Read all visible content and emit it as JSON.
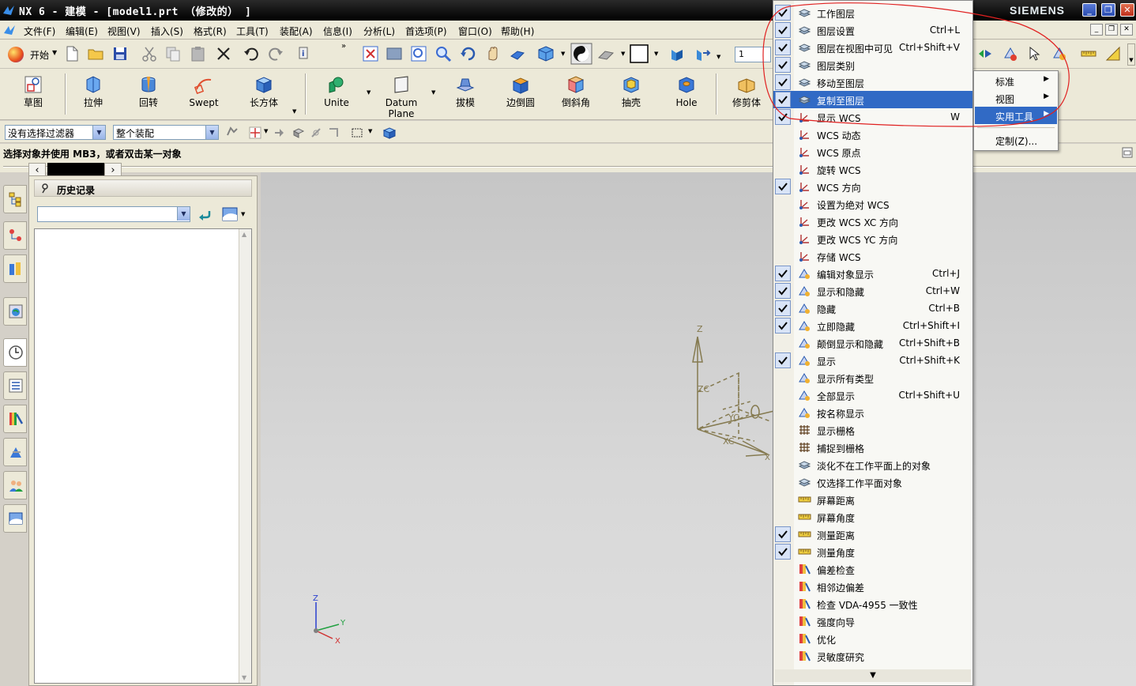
{
  "window": {
    "title": "NX 6 - 建模 - [model1.prt （修改的） ]",
    "brand": "SIEMENS"
  },
  "menubar": {
    "items": [
      "文件(F)",
      "编辑(E)",
      "视图(V)",
      "插入(S)",
      "格式(R)",
      "工具(T)",
      "装配(A)",
      "信息(I)",
      "分析(L)",
      "首选项(P)",
      "窗口(O)",
      "帮助(H)"
    ]
  },
  "toolbar": {
    "start_label": "开始",
    "layer_value": "1"
  },
  "features": [
    {
      "label": "草图",
      "icon": "sketch-icon"
    },
    {
      "label": "拉伸",
      "icon": "extrude-icon"
    },
    {
      "label": "回转",
      "icon": "revolve-icon"
    },
    {
      "label": "Swept",
      "icon": "swept-icon"
    },
    {
      "label": "长方体",
      "icon": "block-icon"
    },
    {
      "label": "Unite",
      "icon": "unite-icon"
    },
    {
      "label": "Datum Plane",
      "icon": "datum-plane-icon"
    },
    {
      "label": "拔模",
      "icon": "draft-icon"
    },
    {
      "label": "边倒圆",
      "icon": "edge-blend-icon"
    },
    {
      "label": "倒斜角",
      "icon": "chamfer-icon"
    },
    {
      "label": "抽壳",
      "icon": "shell-icon"
    },
    {
      "label": "Hole",
      "icon": "hole-icon"
    },
    {
      "label": "修剪体",
      "icon": "trim-body-icon"
    }
  ],
  "selection": {
    "filter": "没有选择过滤器",
    "scope": "整个装配"
  },
  "status": {
    "message": "选择对象并使用 MB3，或者双击某一对象"
  },
  "history_panel": {
    "title": "历史记录"
  },
  "context_menu": {
    "items": [
      {
        "label": "工作图层",
        "shortcut": "",
        "checked": true
      },
      {
        "label": "图层设置",
        "shortcut": "Ctrl+L",
        "checked": true
      },
      {
        "label": "图层在视图中可见",
        "shortcut": "Ctrl+Shift+V",
        "checked": true
      },
      {
        "label": "图层类别",
        "shortcut": "",
        "checked": true
      },
      {
        "label": "移动至图层",
        "shortcut": "",
        "checked": true
      },
      {
        "label": "复制至图层",
        "shortcut": "",
        "checked": true
      },
      {
        "label": "显示 WCS",
        "shortcut": "W",
        "checked": true
      },
      {
        "label": "WCS 动态",
        "shortcut": "",
        "checked": false
      },
      {
        "label": "WCS 原点",
        "shortcut": "",
        "checked": false
      },
      {
        "label": "旋转 WCS",
        "shortcut": "",
        "checked": false
      },
      {
        "label": "WCS 方向",
        "shortcut": "",
        "checked": true
      },
      {
        "label": "设置为绝对 WCS",
        "shortcut": "",
        "checked": false
      },
      {
        "label": "更改 WCS XC 方向",
        "shortcut": "",
        "checked": false
      },
      {
        "label": "更改 WCS YC 方向",
        "shortcut": "",
        "checked": false
      },
      {
        "label": "存储 WCS",
        "shortcut": "",
        "checked": false
      },
      {
        "label": "编辑对象显示",
        "shortcut": "Ctrl+J",
        "checked": true
      },
      {
        "label": "显示和隐藏",
        "shortcut": "Ctrl+W",
        "checked": true
      },
      {
        "label": "隐藏",
        "shortcut": "Ctrl+B",
        "checked": true
      },
      {
        "label": "立即隐藏",
        "shortcut": "Ctrl+Shift+I",
        "checked": true
      },
      {
        "label": "颠倒显示和隐藏",
        "shortcut": "Ctrl+Shift+B",
        "checked": false
      },
      {
        "label": "显示",
        "shortcut": "Ctrl+Shift+K",
        "checked": true
      },
      {
        "label": "显示所有类型",
        "shortcut": "",
        "checked": false
      },
      {
        "label": "全部显示",
        "shortcut": "Ctrl+Shift+U",
        "checked": false
      },
      {
        "label": "按名称显示",
        "shortcut": "",
        "checked": false
      },
      {
        "label": "显示栅格",
        "shortcut": "",
        "checked": false
      },
      {
        "label": "捕捉到栅格",
        "shortcut": "",
        "checked": false
      },
      {
        "label": "淡化不在工作平面上的对象",
        "shortcut": "",
        "checked": false
      },
      {
        "label": "仅选择工作平面对象",
        "shortcut": "",
        "checked": false
      },
      {
        "label": "屏幕距离",
        "shortcut": "",
        "checked": false
      },
      {
        "label": "屏幕角度",
        "shortcut": "",
        "checked": false
      },
      {
        "label": "测量距离",
        "shortcut": "",
        "checked": true
      },
      {
        "label": "测量角度",
        "shortcut": "",
        "checked": true
      },
      {
        "label": "偏差检查",
        "shortcut": "",
        "checked": false
      },
      {
        "label": "相邻边偏差",
        "shortcut": "",
        "checked": false
      },
      {
        "label": "检查 VDA-4955 一致性",
        "shortcut": "",
        "checked": false
      },
      {
        "label": "强度向导",
        "shortcut": "",
        "checked": false
      },
      {
        "label": "优化",
        "shortcut": "",
        "checked": false
      },
      {
        "label": "灵敏度研究",
        "shortcut": "",
        "checked": false
      }
    ],
    "highlighted_index": 5
  },
  "submenu": {
    "items": [
      {
        "label": "标准",
        "has_arrow": true
      },
      {
        "label": "视图",
        "has_arrow": true
      },
      {
        "label": "实用工具",
        "has_arrow": true
      },
      {
        "label": "定制(Z)...",
        "has_arrow": false
      }
    ],
    "highlighted_index": 2
  },
  "triad": {
    "z": "Z",
    "y": "Y",
    "x": "X",
    "zc": "ZC",
    "xc": "XC",
    "yc": "YC"
  },
  "colors": {
    "highlight": "#316ac5",
    "annotation": "#e02020",
    "wcs": "#857a50"
  }
}
